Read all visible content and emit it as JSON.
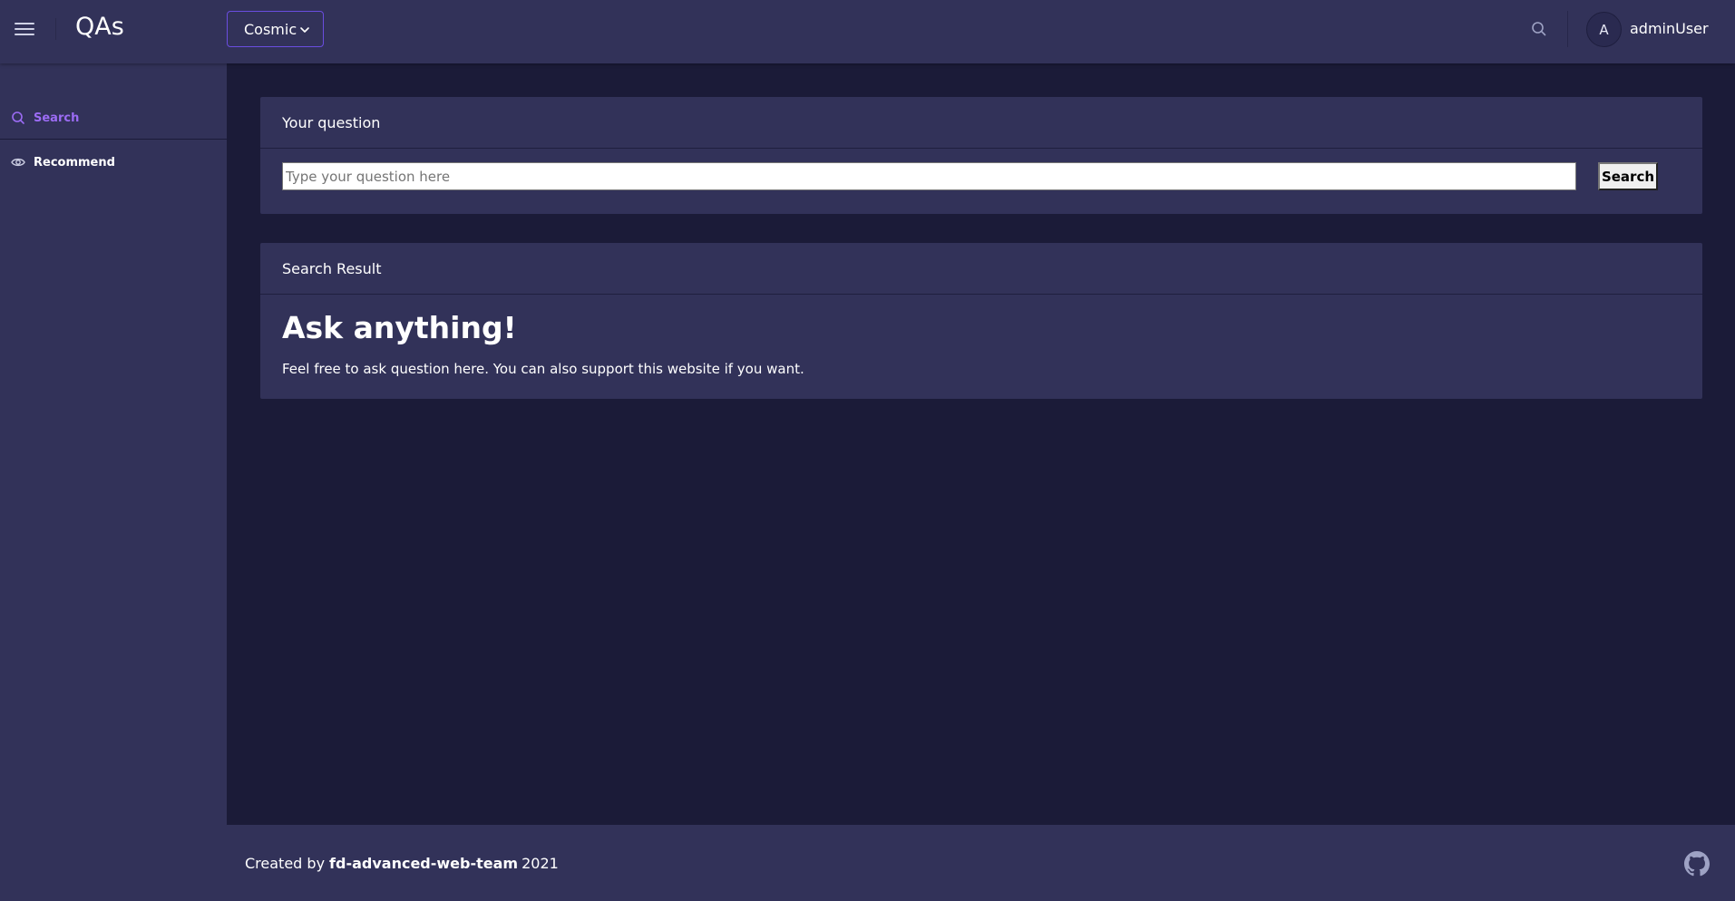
{
  "header": {
    "brand": "QAs",
    "theme_selected": "Cosmic",
    "avatar_initial": "A",
    "username": "adminUser"
  },
  "sidebar": {
    "items": [
      {
        "label": "Search",
        "icon": "search-icon",
        "active": true
      },
      {
        "label": "Recommend",
        "icon": "eye-icon",
        "active": false
      }
    ]
  },
  "question_card": {
    "title": "Your question",
    "input_placeholder": "Type your question here",
    "input_value": "",
    "button_label": "Search"
  },
  "result_card": {
    "title": "Search Result",
    "heading": "Ask anything!",
    "text": "Feel free to ask question here. You can also support this website if you want."
  },
  "footer": {
    "prefix": "Created by",
    "team": "fd-advanced-web-team",
    "year": "2021",
    "icon": "github-icon"
  },
  "colors": {
    "background": "#1b1b38",
    "panel": "#323259",
    "accent": "#9c6cf5",
    "select_border": "#6a4de0"
  }
}
